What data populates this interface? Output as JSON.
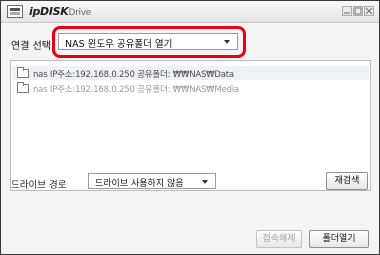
{
  "window": {
    "title_brand": "ipDISK",
    "title_sub": "Drive"
  },
  "connection": {
    "label": "연결 선택",
    "selected": "NAS 윈도우 공유폴더 열기"
  },
  "folders": [
    {
      "text": "nas IP주소:192.168.0.250 공유폴더: ₩₩NAS₩Data"
    },
    {
      "text": "nas IP주소:192.168.0.250 공유폴더: ₩₩NAS₩Media"
    }
  ],
  "drive": {
    "label": "드라이브 경로",
    "selected": "드라이브 사용하지 않음"
  },
  "buttons": {
    "rescan": "재검색",
    "disconnect": "접속해제",
    "open_folder": "폴더열기"
  },
  "colors": {
    "highlight": "#e60012"
  }
}
